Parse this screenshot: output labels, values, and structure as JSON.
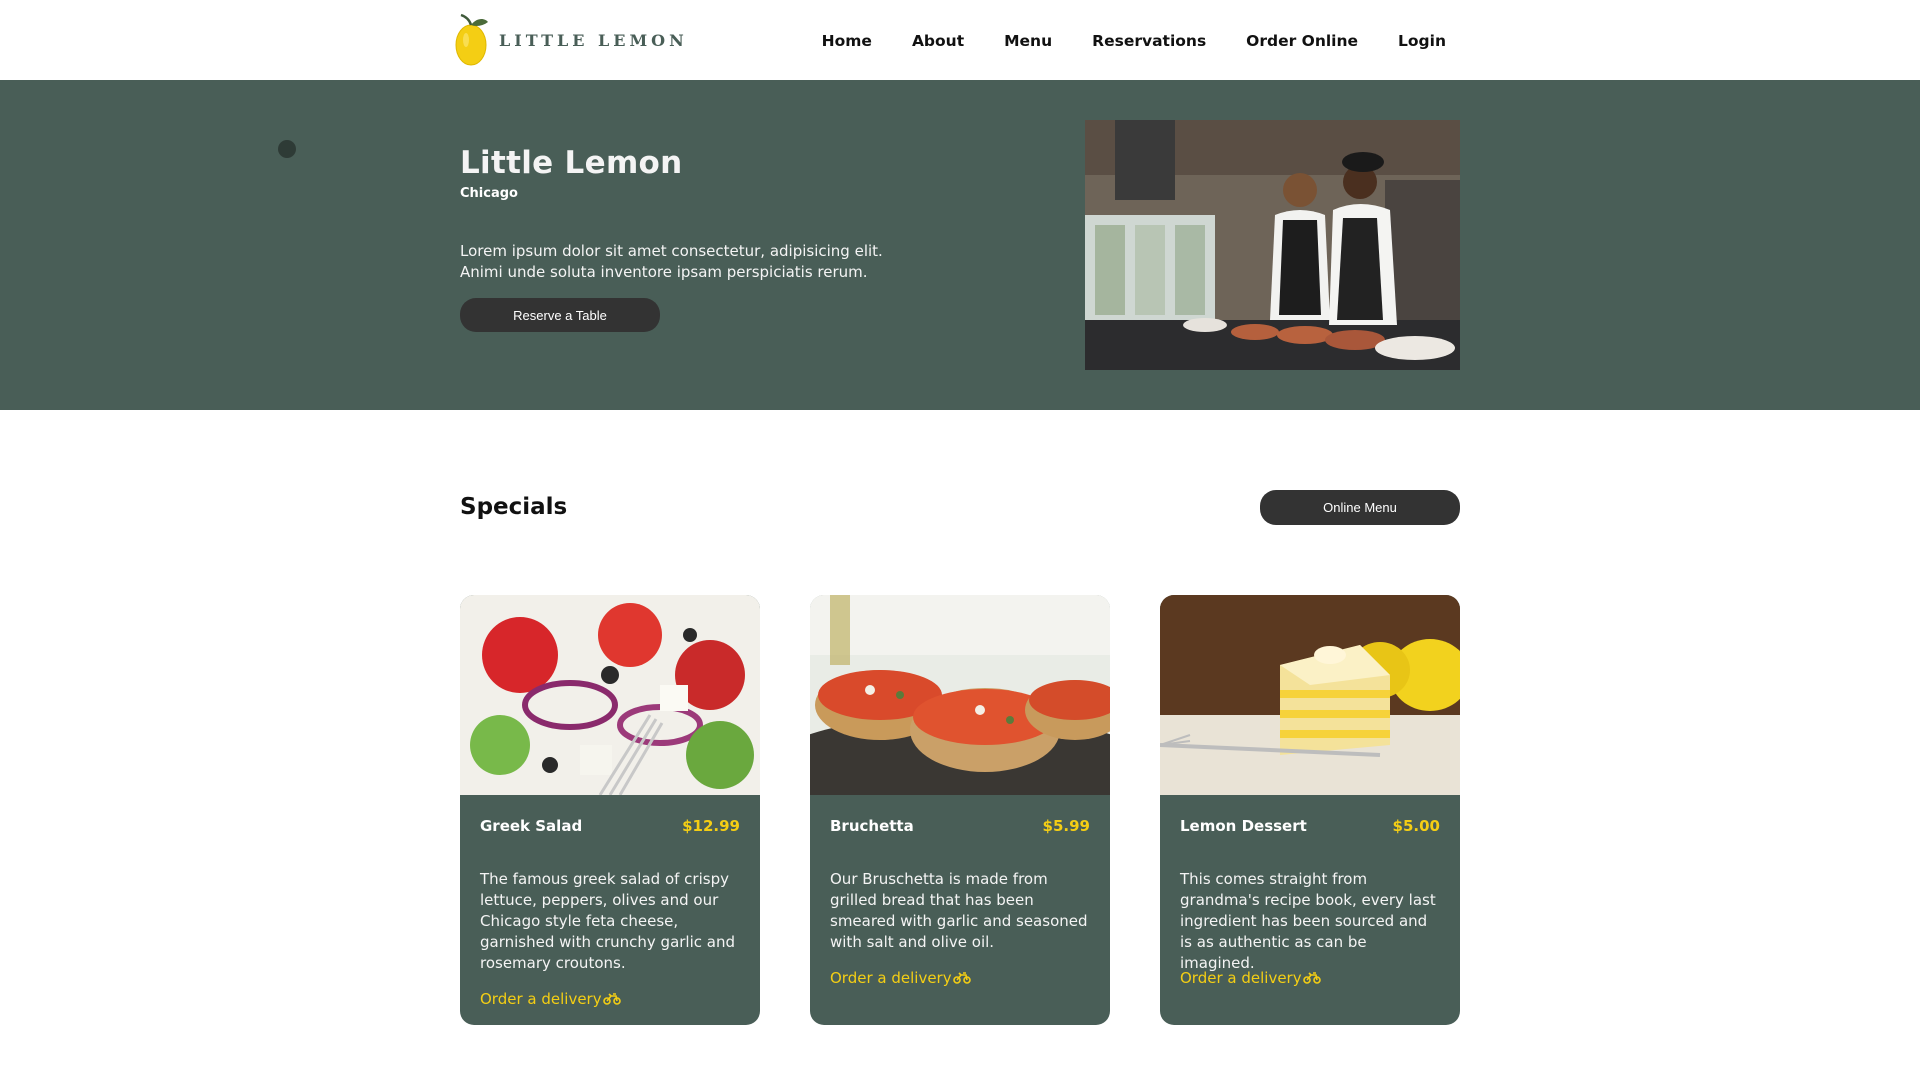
{
  "brand": {
    "name": "LITTLE LEMON",
    "accent": "#f4ce14",
    "primary": "#495e57"
  },
  "nav": {
    "items": [
      {
        "label": "Home"
      },
      {
        "label": "About"
      },
      {
        "label": "Menu"
      },
      {
        "label": "Reservations"
      },
      {
        "label": "Order Online"
      },
      {
        "label": "Login"
      }
    ]
  },
  "hero": {
    "title": "Little Lemon",
    "subtitle": "Chicago",
    "description": "Lorem ipsum dolor sit amet consectetur, adipisicing elit. Animi unde soluta inventore ipsam perspiciatis rerum.",
    "button_label": "Reserve a Table",
    "image_icon": "chefs-photo"
  },
  "specials": {
    "title": "Specials",
    "menu_button_label": "Online Menu",
    "cards": [
      {
        "name": "Greek Salad",
        "price": "$12.99",
        "description": "The famous greek salad of crispy lettuce, peppers, olives and our Chicago style feta cheese, garnished with crunchy garlic and rosemary croutons.",
        "link_label": "Order a delivery",
        "icon": "bike-icon"
      },
      {
        "name": "Bruchetta",
        "price": "$5.99",
        "description": "Our Bruschetta is made from grilled bread that has been smeared with garlic and seasoned with salt and olive oil.",
        "link_label": "Order a delivery",
        "icon": "bike-icon"
      },
      {
        "name": "Lemon Dessert",
        "price": "$5.00",
        "description": "This comes straight from grandma's recipe book, every last ingredient has been sourced and is as authentic as can be imagined.",
        "link_label": "Order a delivery",
        "icon": "bike-icon"
      }
    ]
  }
}
